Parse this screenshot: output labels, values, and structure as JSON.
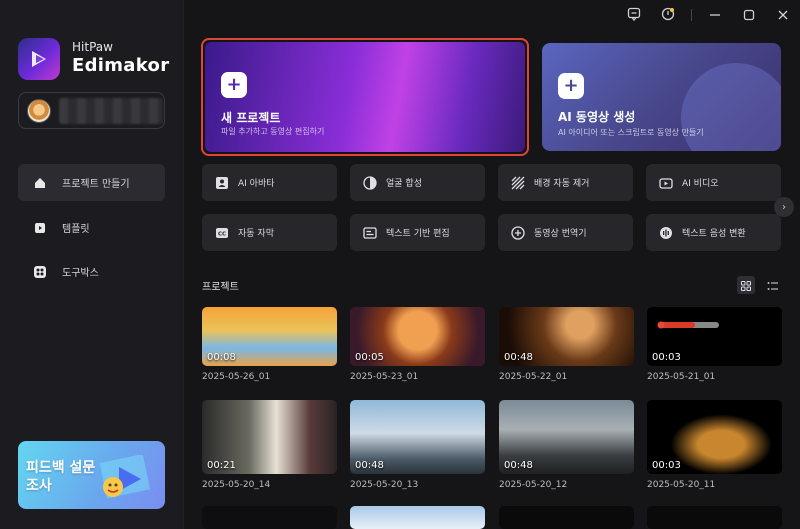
{
  "brand": {
    "top": "HitPaw",
    "bottom": "Edimakor"
  },
  "nav": [
    {
      "label": "프로젝트 만들기",
      "icon": "home-icon",
      "active": true
    },
    {
      "label": "템플릿",
      "icon": "template-icon",
      "active": false
    },
    {
      "label": "도구박스",
      "icon": "toolbox-icon",
      "active": false
    }
  ],
  "feedback": {
    "label": "피드백 설문조사"
  },
  "hero": {
    "new_project": {
      "title": "새 프로젝트",
      "subtitle": "파일 추가하고 동영상 편집하기"
    },
    "ai_video": {
      "title": "AI 동영상 생성",
      "subtitle": "AI 아이디어 또는 스크립트로 동영상 만들기"
    }
  },
  "tools": [
    {
      "label": "AI 아바타",
      "icon": "avatar-icon"
    },
    {
      "label": "얼굴 합성",
      "icon": "face-swap-icon"
    },
    {
      "label": "배경 자동 제거",
      "icon": "bg-remove-icon"
    },
    {
      "label": "AI 비디오",
      "icon": "ai-video-icon"
    },
    {
      "label": "자동 자막",
      "icon": "cc-icon"
    },
    {
      "label": "텍스트 기반 편집",
      "icon": "text-edit-icon"
    },
    {
      "label": "동영상 번역기",
      "icon": "translate-icon"
    },
    {
      "label": "텍스트 음성 변환",
      "icon": "tts-icon"
    }
  ],
  "projects_section": {
    "title": "프로젝트"
  },
  "projects": [
    {
      "date": "2025-05-26_01",
      "duration": "00:08"
    },
    {
      "date": "2025-05-23_01",
      "duration": "00:05"
    },
    {
      "date": "2025-05-22_01",
      "duration": "00:48"
    },
    {
      "date": "2025-05-21_01",
      "duration": "00:03"
    },
    {
      "date": "2025-05-20_14",
      "duration": "00:21"
    },
    {
      "date": "2025-05-20_13",
      "duration": "00:48"
    },
    {
      "date": "2025-05-20_12",
      "duration": "00:48"
    },
    {
      "date": "2025-05-20_11",
      "duration": "00:03"
    }
  ],
  "colors": {
    "accent": "#8a2ed8",
    "highlight_border": "#e0453a",
    "background": "#151518"
  }
}
